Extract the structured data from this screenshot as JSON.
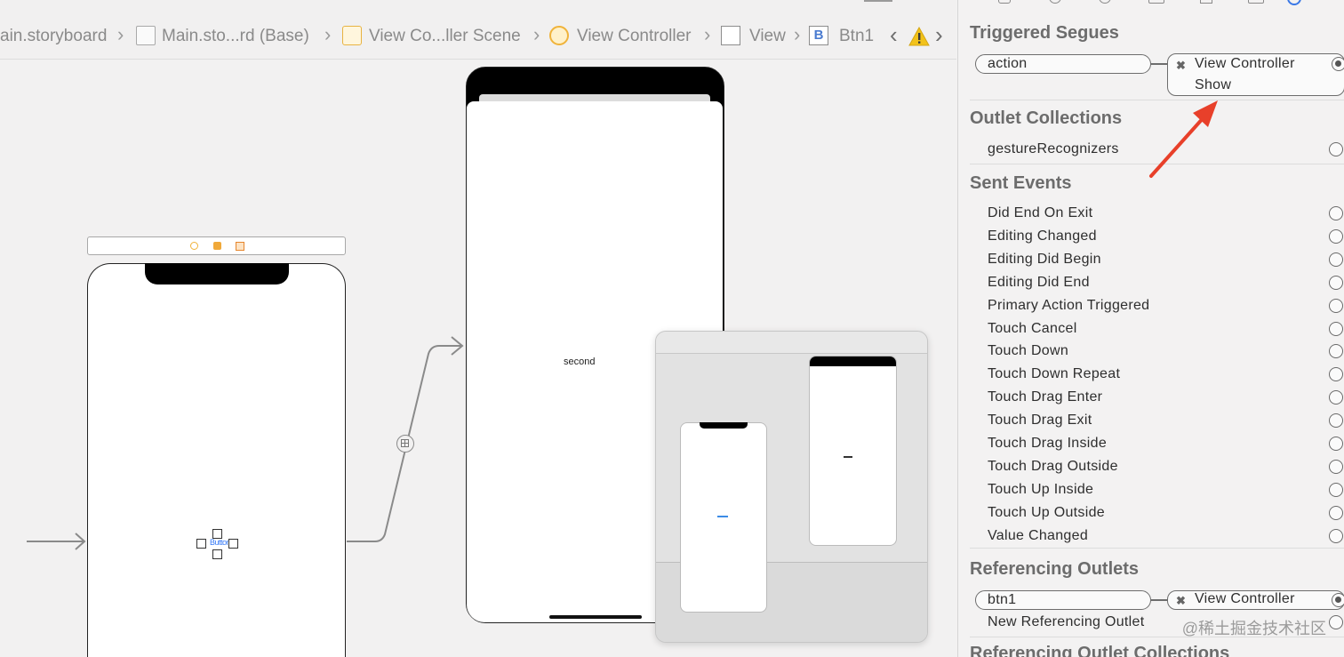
{
  "breadcrumb": {
    "items": [
      {
        "label": "ain.storyboard",
        "icon": "storyboard-icon"
      },
      {
        "label": "Main.sto...rd (Base)",
        "icon": "file-icon"
      },
      {
        "label": "View Co...ller Scene",
        "icon": "scene-icon"
      },
      {
        "label": "View Controller",
        "icon": "view-controller-icon"
      },
      {
        "label": "View",
        "icon": "view-icon"
      },
      {
        "label": "Btn1",
        "icon": "button-icon"
      }
    ],
    "button_glyph": "B"
  },
  "canvas": {
    "second_label": "second",
    "first_button_label": "Button"
  },
  "inspector": {
    "triggered_segues": {
      "title": "Triggered Segues",
      "source": "action",
      "target_name": "View Controller",
      "target_kind": "Show"
    },
    "outlet_collections": {
      "title": "Outlet Collections",
      "items": [
        "gestureRecognizers"
      ]
    },
    "sent_events": {
      "title": "Sent Events",
      "items": [
        "Did End On Exit",
        "Editing Changed",
        "Editing Did Begin",
        "Editing Did End",
        "Primary Action Triggered",
        "Touch Cancel",
        "Touch Down",
        "Touch Down Repeat",
        "Touch Drag Enter",
        "Touch Drag Exit",
        "Touch Drag Inside",
        "Touch Drag Outside",
        "Touch Up Inside",
        "Touch Up Outside",
        "Value Changed"
      ]
    },
    "referencing_outlets": {
      "title": "Referencing Outlets",
      "source": "btn1",
      "target_name": "View Controller",
      "new_label": "New Referencing Outlet"
    },
    "referencing_outlet_collections": {
      "title": "Referencing Outlet Collections"
    }
  },
  "watermark": "@稀土掘金技术社区",
  "colors": {
    "annotation_arrow": "#e8402a",
    "scene_dock_icon": "#f0b33a"
  }
}
